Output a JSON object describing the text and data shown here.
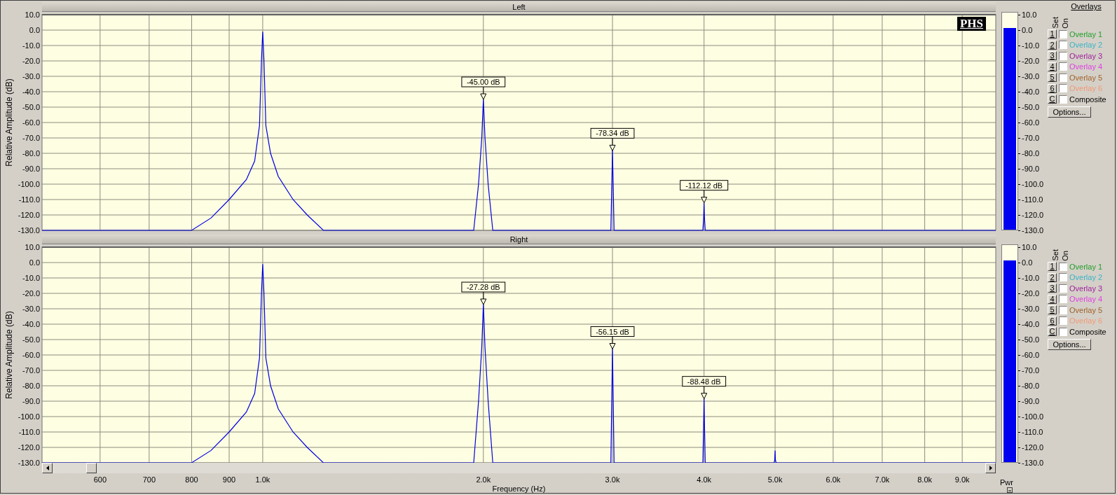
{
  "channels": [
    {
      "title": "Left",
      "logo": "PHS",
      "y_axis": {
        "title": "Relative Amplitude (dB)",
        "ticks": [
          "10.0",
          "0.0",
          "-10.0",
          "-20.0",
          "-30.0",
          "-40.0",
          "-50.0",
          "-60.0",
          "-70.0",
          "-80.0",
          "-90.0",
          "-100.0",
          "-110.0",
          "-120.0",
          "-130.0"
        ]
      },
      "peak_labels": [
        "-45.00 dB",
        "-78.34 dB",
        "-112.12 dB"
      ],
      "meter": {
        "level": 0.929,
        "scale": [
          "10.0",
          "0.0",
          "-10.0",
          "-20.0",
          "-30.0",
          "-40.0",
          "-50.0",
          "-60.0",
          "-70.0",
          "-80.0",
          "-90.0",
          "-100.0",
          "-110.0",
          "-120.0",
          "-130.0"
        ]
      },
      "overlays": {
        "title": "Overlays",
        "set_label": "Set",
        "on_label": "On",
        "options_button": "Options...",
        "items": [
          {
            "set": "1",
            "checked": false,
            "name": "Overlay 1",
            "color": "#22a02a"
          },
          {
            "set": "2",
            "checked": false,
            "name": "Overlay 2",
            "color": "#3ab4c4"
          },
          {
            "set": "3",
            "checked": false,
            "name": "Overlay 3",
            "color": "#a0209c"
          },
          {
            "set": "4",
            "checked": false,
            "name": "Overlay 4",
            "color": "#e040e0"
          },
          {
            "set": "5",
            "checked": false,
            "name": "Overlay 5",
            "color": "#a0622a"
          },
          {
            "set": "6",
            "checked": false,
            "name": "Overlay 6",
            "color": "#f09a78"
          },
          {
            "set": "C",
            "checked": false,
            "name": "Composite",
            "color": "#000000"
          }
        ]
      }
    },
    {
      "title": "Right",
      "y_axis": {
        "title": "Relative Amplitude (dB)",
        "ticks": [
          "10.0",
          "0.0",
          "-10.0",
          "-20.0",
          "-30.0",
          "-40.0",
          "-50.0",
          "-60.0",
          "-70.0",
          "-80.0",
          "-90.0",
          "-100.0",
          "-110.0",
          "-120.0",
          "-130.0"
        ]
      },
      "peak_labels": [
        "-27.28 dB",
        "-56.15 dB",
        "-88.48 dB"
      ],
      "meter": {
        "level": 0.929,
        "scale": [
          "10.0",
          "0.0",
          "-10.0",
          "-20.0",
          "-30.0",
          "-40.0",
          "-50.0",
          "-60.0",
          "-70.0",
          "-80.0",
          "-90.0",
          "-100.0",
          "-110.0",
          "-120.0",
          "-130.0"
        ]
      },
      "overlays": {
        "set_label": "Set",
        "on_label": "On",
        "options_button": "Options...",
        "items": [
          {
            "set": "1",
            "checked": false,
            "name": "Overlay 1",
            "color": "#22a02a"
          },
          {
            "set": "2",
            "checked": false,
            "name": "Overlay 2",
            "color": "#3ab4c4"
          },
          {
            "set": "3",
            "checked": false,
            "name": "Overlay 3",
            "color": "#a0209c"
          },
          {
            "set": "4",
            "checked": false,
            "name": "Overlay 4",
            "color": "#e040e0"
          },
          {
            "set": "5",
            "checked": false,
            "name": "Overlay 5",
            "color": "#a0622a"
          },
          {
            "set": "6",
            "checked": false,
            "name": "Overlay 6",
            "color": "#f09a78"
          },
          {
            "set": "C",
            "checked": false,
            "name": "Composite",
            "color": "#000000"
          }
        ]
      }
    }
  ],
  "x_axis": {
    "title": "Frequency (Hz)",
    "ticks": [
      "600",
      "700",
      "800",
      "900",
      "1.0k",
      "2.0k",
      "3.0k",
      "4.0k",
      "5.0k",
      "6.0k",
      "7.0k",
      "8.0k",
      "9.0k"
    ]
  },
  "meter_label": "Pwr"
}
